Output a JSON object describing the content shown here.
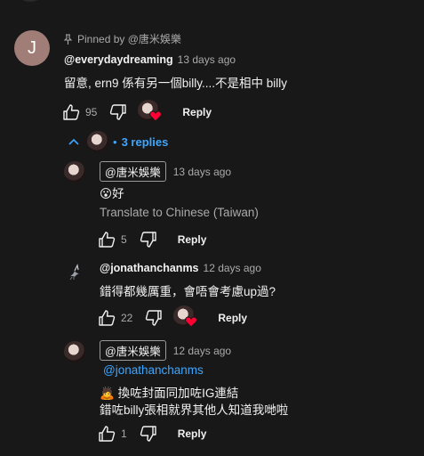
{
  "comments": [
    {
      "avatar_letter": "J",
      "pinned_label": "Pinned by @唐米娛樂",
      "author": "@everydaydreaming",
      "time": "13 days ago",
      "text": "留意, ern9 係有另一個billy....不是相中 billy",
      "likes": "95",
      "reply_label": "Reply",
      "replies_label": "3 replies"
    }
  ],
  "replies": [
    {
      "author": "@唐米娛樂",
      "time": "13 days ago",
      "emoji": "😮",
      "text": "好",
      "translate": "Translate to Chinese (Taiwan)",
      "likes": "5",
      "reply_label": "Reply"
    },
    {
      "author": "@jonathanchanms",
      "time": "12 days ago",
      "text": "錯得都幾厲重，會唔會考慮up過?",
      "likes": "22",
      "reply_label": "Reply"
    },
    {
      "author": "@唐米娛樂",
      "time": "12 days ago",
      "mention": "@jonathanchanms",
      "emoji": "🙇",
      "line1": "換咗封面同加咗IG連結",
      "line2": "錯咗billy張相就界其他人知道我哋啦",
      "likes": "1",
      "reply_label": "Reply"
    }
  ],
  "icons": {
    "pin": "pin-icon",
    "like": "thumbs-up-icon",
    "dislike": "thumbs-down-icon",
    "heart": "creator-heart-icon",
    "collapse": "chevron-up-icon"
  },
  "colors": {
    "background": "#181818",
    "link": "#3ea6ff",
    "heart": "#ff0033",
    "avatar_j": "#a07e77"
  }
}
